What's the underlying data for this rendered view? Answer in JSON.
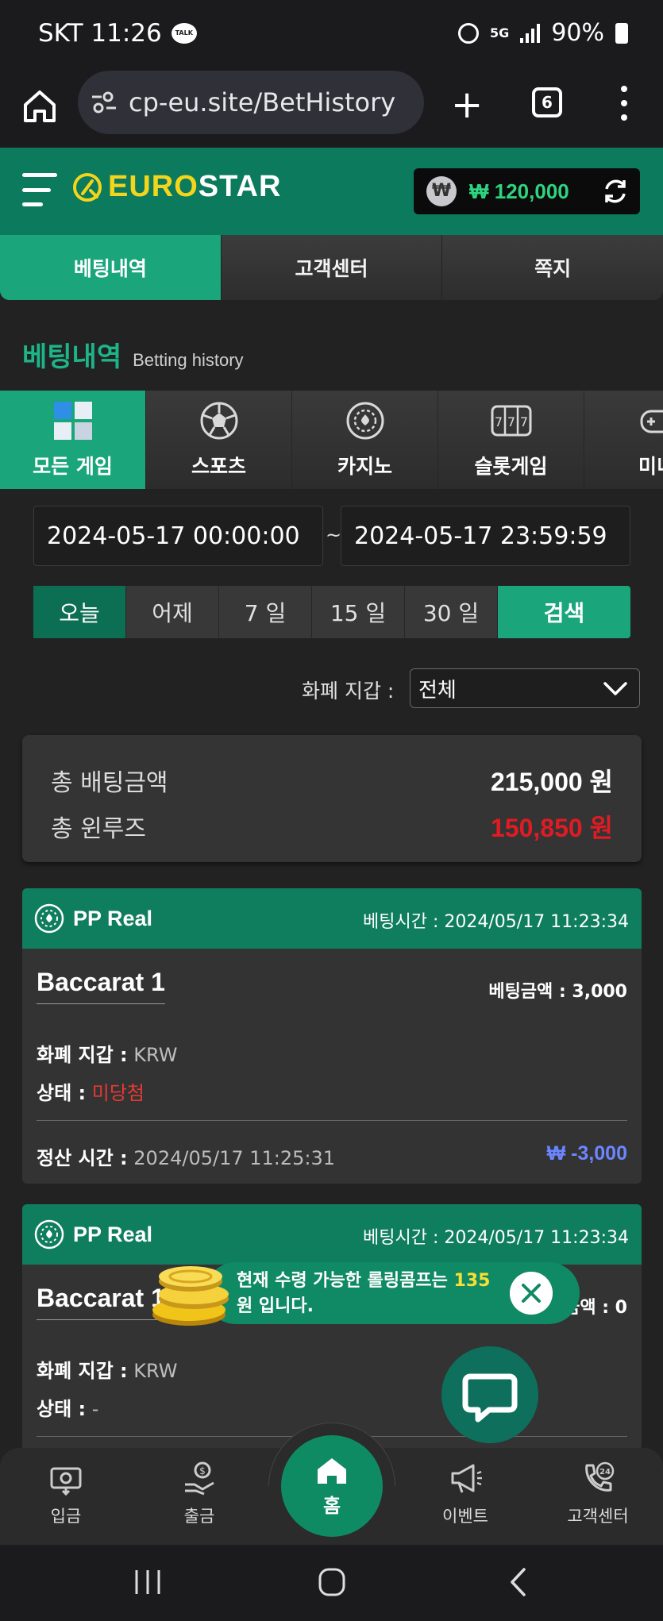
{
  "status_bar": {
    "carrier_time": "SKT 11:26",
    "talk_badge": "TALK",
    "network": "5G",
    "battery": "90%"
  },
  "browser": {
    "url": "cp-eu.site/BetHistory",
    "tab_count": "6"
  },
  "header": {
    "logo_euro": "EURO",
    "logo_star": "STAR",
    "won_symbol": "₩",
    "balance": "₩ 120,000"
  },
  "tabs": [
    {
      "label": "베팅내역",
      "active": true
    },
    {
      "label": "고객센터",
      "active": false
    },
    {
      "label": "쪽지",
      "active": false
    }
  ],
  "page_title": {
    "korean": "베팅내역",
    "english": "Betting history"
  },
  "categories": [
    {
      "label": "모든 게임",
      "icon": "cubes-icon",
      "active": true
    },
    {
      "label": "스포츠",
      "icon": "soccer-ball-icon",
      "active": false
    },
    {
      "label": "카지노",
      "icon": "casino-chip-icon",
      "active": false
    },
    {
      "label": "슬롯게임",
      "icon": "slot-machine-icon",
      "active": false
    },
    {
      "label": "미니",
      "icon": "gamepad-icon",
      "active": false
    }
  ],
  "date_range": {
    "start": "2024-05-17 00:00:00",
    "separator": "~",
    "end": "2024-05-17 23:59:59"
  },
  "periods": [
    {
      "label": "오늘",
      "active": true
    },
    {
      "label": "어제",
      "active": false
    },
    {
      "label": "7 일",
      "active": false
    },
    {
      "label": "15 일",
      "active": false
    },
    {
      "label": "30 일",
      "active": false
    }
  ],
  "search_label": "검색",
  "wallet_filter": {
    "label": "화폐 지갑 :",
    "value": "전체"
  },
  "summary": {
    "total_bet_label": "총 배팅금액",
    "total_bet_value": "215,000 원",
    "total_winloss_label": "총 윈루즈",
    "total_winloss_value": "150,850 원",
    "winloss_color": "#e01b24"
  },
  "bets": [
    {
      "provider": "PP Real",
      "bet_time": "베팅시간 : 2024/05/17 11:23:34",
      "game": "Baccarat 1",
      "bet_amount": "베팅금액 : 3,000",
      "wallet_label": "화폐 지갑 :",
      "wallet_value": "KRW",
      "status_label": "상태 :",
      "status_value": "미당첨",
      "status_color": "#e53935",
      "settle_label": "정산 시간 :",
      "settle_time": "2024/05/17 11:25:31",
      "settle_amount": "₩ -3,000"
    },
    {
      "provider": "PP Real",
      "bet_time": "베팅시간 : 2024/05/17 11:23:34",
      "game": "Baccarat 1",
      "bet_amount": "팅금액 : 0",
      "wallet_label": "화폐 지갑 :",
      "wallet_value": "KRW",
      "status_label": "상태 :",
      "status_value": "-",
      "status_color": "#bdbdbd"
    }
  ],
  "toast": {
    "text_before": "현재 수령 가능한 롤링콤프는 ",
    "number": "135",
    "text_after": " 원 입니다."
  },
  "bottom_nav": [
    {
      "label": "입금",
      "icon": "deposit-icon"
    },
    {
      "label": "출금",
      "icon": "withdraw-icon"
    },
    {
      "label": "홈",
      "icon": "home-icon"
    },
    {
      "label": "이벤트",
      "icon": "megaphone-icon"
    },
    {
      "label": "고객센터",
      "icon": "support-24-icon"
    }
  ],
  "colors": {
    "brand_green": "#0c7a5c",
    "accent_green": "#1aa67a",
    "logo_yellow": "#f3d51c",
    "balance_green": "#2ed47f",
    "negative_blue": "#6b86ff"
  }
}
